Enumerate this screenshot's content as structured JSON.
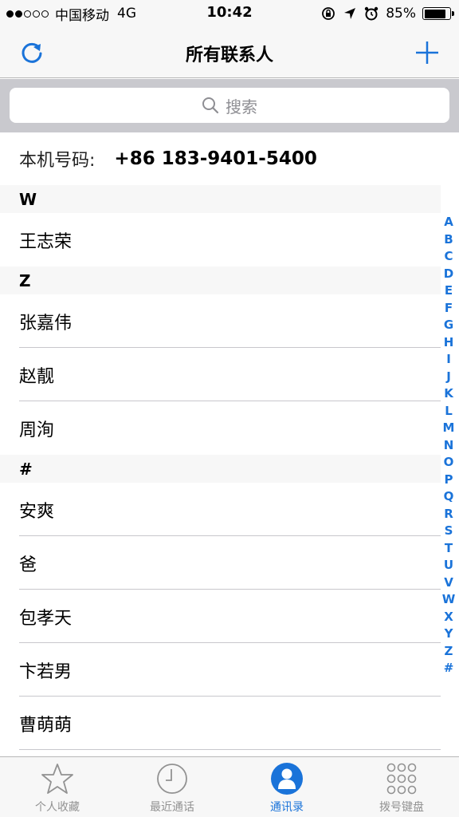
{
  "status_bar": {
    "carrier": "中国移动",
    "network": "4G",
    "time": "10:42",
    "battery_text": "85%",
    "battery_level": 0.85,
    "signal_dots_full": 2,
    "signal_dots_total": 5
  },
  "nav": {
    "title": "所有联系人",
    "accent_color": "#1a73d9"
  },
  "search": {
    "placeholder": "搜索"
  },
  "my_number": {
    "label": "本机号码:",
    "value": "+86 183-9401-5400"
  },
  "sections": [
    {
      "header": "W",
      "contacts": [
        "王志荣"
      ]
    },
    {
      "header": "Z",
      "contacts": [
        "张嘉伟",
        "赵靓",
        "周洵"
      ]
    },
    {
      "header": "#",
      "contacts": [
        "安爽",
        "爸",
        "包孝天",
        "卞若男",
        "曹萌萌"
      ]
    }
  ],
  "index_letters": [
    "A",
    "B",
    "C",
    "D",
    "E",
    "F",
    "G",
    "H",
    "I",
    "J",
    "K",
    "L",
    "M",
    "N",
    "O",
    "P",
    "Q",
    "R",
    "S",
    "T",
    "U",
    "V",
    "W",
    "X",
    "Y",
    "Z",
    "#"
  ],
  "tabs": [
    {
      "label": "个人收藏",
      "icon": "star-icon",
      "active": false
    },
    {
      "label": "最近通话",
      "icon": "clock-icon",
      "active": false
    },
    {
      "label": "通讯录",
      "icon": "contacts-icon",
      "active": true
    },
    {
      "label": "拨号键盘",
      "icon": "keypad-icon",
      "active": false
    }
  ]
}
